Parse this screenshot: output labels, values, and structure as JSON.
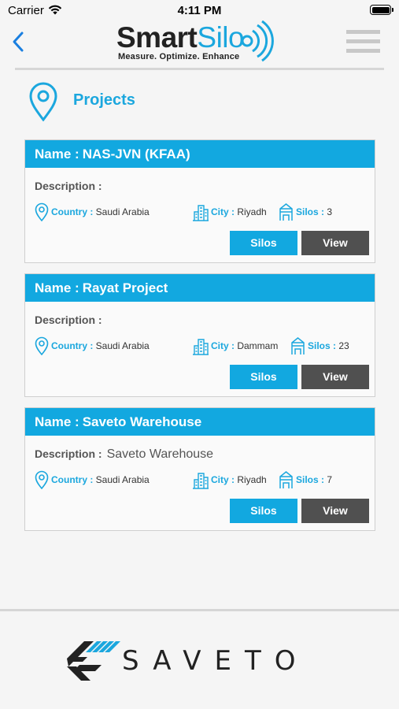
{
  "status_bar": {
    "carrier": "Carrier",
    "time": "4:11 PM"
  },
  "header": {
    "logo_smart": "Smart",
    "logo_silo": "Silo",
    "logo_tagline": "Measure. Optimize. Enhance",
    "accent_color": "#1ba7de"
  },
  "page": {
    "title": "Projects"
  },
  "labels": {
    "name": "Name :",
    "description": "Description :",
    "country": "Country :",
    "city": "City :",
    "silos": "Silos :",
    "silos_button": "Silos",
    "view_button": "View"
  },
  "projects": [
    {
      "name": "NAS-JVN (KFAA)",
      "description": "",
      "country": "Saudi Arabia",
      "city": "Riyadh",
      "silos": "3"
    },
    {
      "name": "Rayat Project",
      "description": "",
      "country": "Saudi Arabia",
      "city": "Dammam",
      "silos": "23"
    },
    {
      "name": "Saveto Warehouse",
      "description": "Saveto Warehouse",
      "country": "Saudi Arabia",
      "city": "Riyadh",
      "silos": "7"
    }
  ],
  "footer": {
    "brand": "SAVETO"
  }
}
